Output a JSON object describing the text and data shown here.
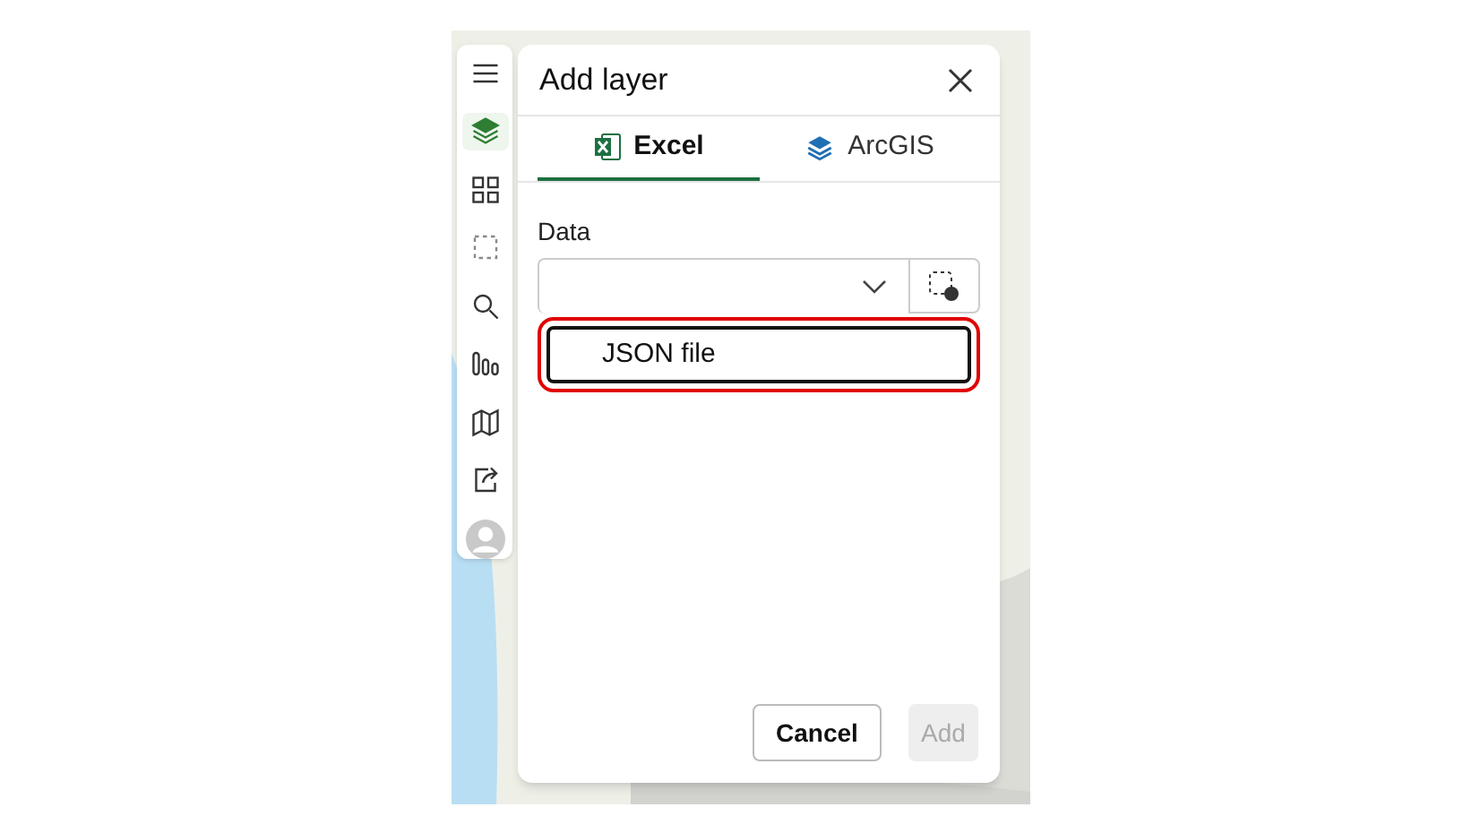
{
  "toolbar": {
    "items": [
      {
        "kind": "menu",
        "selected": false
      },
      {
        "kind": "layers",
        "selected": true
      },
      {
        "kind": "qr",
        "selected": false
      },
      {
        "kind": "select",
        "selected": false
      },
      {
        "kind": "search",
        "selected": false
      },
      {
        "kind": "chart",
        "selected": false
      },
      {
        "kind": "map",
        "selected": false
      },
      {
        "kind": "share",
        "selected": false
      },
      {
        "kind": "avatar",
        "selected": false
      }
    ]
  },
  "dialog": {
    "title": "Add layer",
    "tabs": [
      {
        "label": "Excel",
        "kind": "excel",
        "selected": true
      },
      {
        "label": "ArcGIS",
        "kind": "arcgis",
        "selected": false
      }
    ],
    "data_label": "Data",
    "dropdown": {
      "expanded": true,
      "options": [
        {
          "label": "JSON file",
          "highlighted": true
        }
      ]
    },
    "buttons": [
      {
        "label": "Cancel",
        "kind": "secondary",
        "disabled": false
      },
      {
        "label": "Add",
        "kind": "primary",
        "disabled": true
      }
    ]
  }
}
